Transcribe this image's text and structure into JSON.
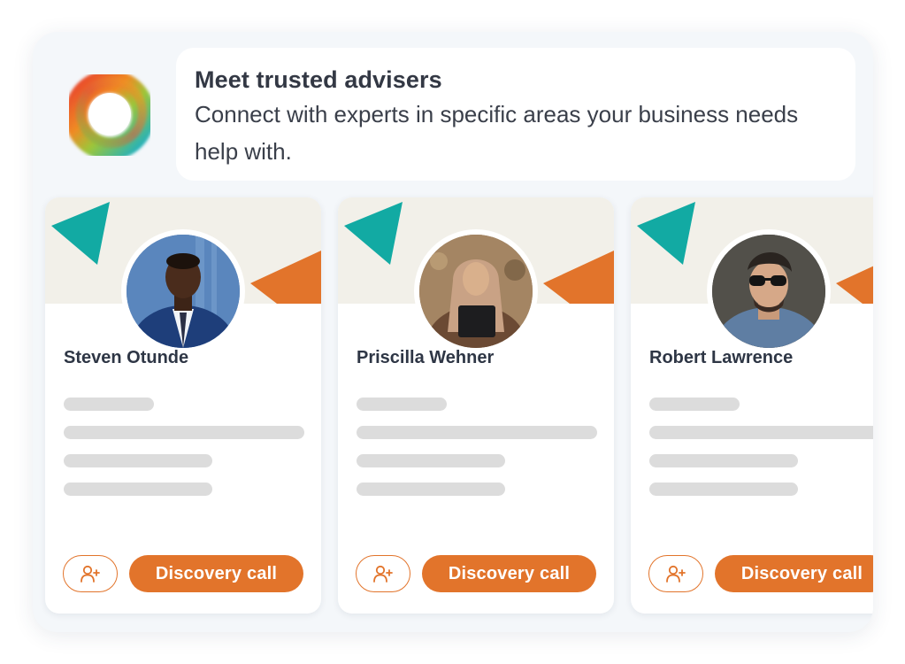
{
  "header": {
    "title": "Meet trusted advisers",
    "description": "Connect with experts in specific areas your business needs help with."
  },
  "logo": {
    "icon": "ring-logo-icon"
  },
  "colors": {
    "accent": "#e2742b",
    "teal": "#12aaa3",
    "banner": "#f2f0e9"
  },
  "advisers": [
    {
      "name": "Steven Otunde",
      "connect_icon": "add-person-icon",
      "cta_label": "Discovery call"
    },
    {
      "name": "Priscilla Wehner",
      "connect_icon": "add-person-icon",
      "cta_label": "Discovery call"
    },
    {
      "name": "Robert Lawrence",
      "connect_icon": "add-person-icon",
      "cta_label": "Discovery call"
    }
  ]
}
